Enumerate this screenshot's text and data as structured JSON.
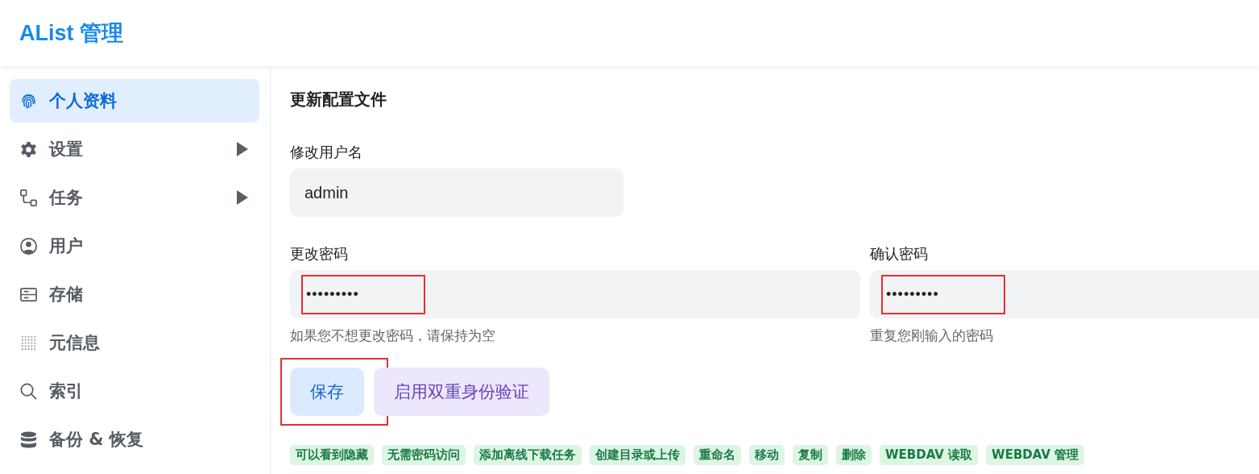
{
  "header": {
    "title": "AList 管理"
  },
  "sidebar": {
    "items": [
      {
        "label": "个人资料",
        "kind": "fingerprint",
        "selected": true,
        "expandable": false
      },
      {
        "label": "设置",
        "kind": "gear",
        "selected": false,
        "expandable": true
      },
      {
        "label": "任务",
        "kind": "flow",
        "selected": false,
        "expandable": true
      },
      {
        "label": "用户",
        "kind": "user",
        "selected": false,
        "expandable": false
      },
      {
        "label": "存储",
        "kind": "storage",
        "selected": false,
        "expandable": false
      },
      {
        "label": "元信息",
        "kind": "dots",
        "selected": false,
        "expandable": false
      },
      {
        "label": "索引",
        "kind": "search",
        "selected": false,
        "expandable": false
      },
      {
        "label": "备份 & 恢复",
        "kind": "database",
        "selected": false,
        "expandable": false
      }
    ]
  },
  "form": {
    "title": "更新配置文件",
    "username": {
      "label": "修改用户名",
      "value": "admin"
    },
    "passwords": [
      {
        "label": "更改密码",
        "value": "•••••••••",
        "hint": "如果您不想更改密码，请保持为空",
        "highlighted": true
      },
      {
        "label": "确认密码",
        "value": "•••••••••",
        "hint": "重复您刚输入的密码",
        "highlighted": true
      }
    ],
    "buttons": [
      {
        "label": "保存",
        "kind": "primary",
        "highlighted": true
      },
      {
        "label": "启用双重身份验证",
        "kind": "secondary",
        "highlighted": false
      }
    ],
    "permissions": [
      "可以看到隐藏",
      "无需密码访问",
      "添加离线下载任务",
      "创建目录或上传",
      "重命名",
      "移动",
      "复制",
      "删除",
      "WEBDAV 读取",
      "WEBDAV 管理"
    ]
  }
}
